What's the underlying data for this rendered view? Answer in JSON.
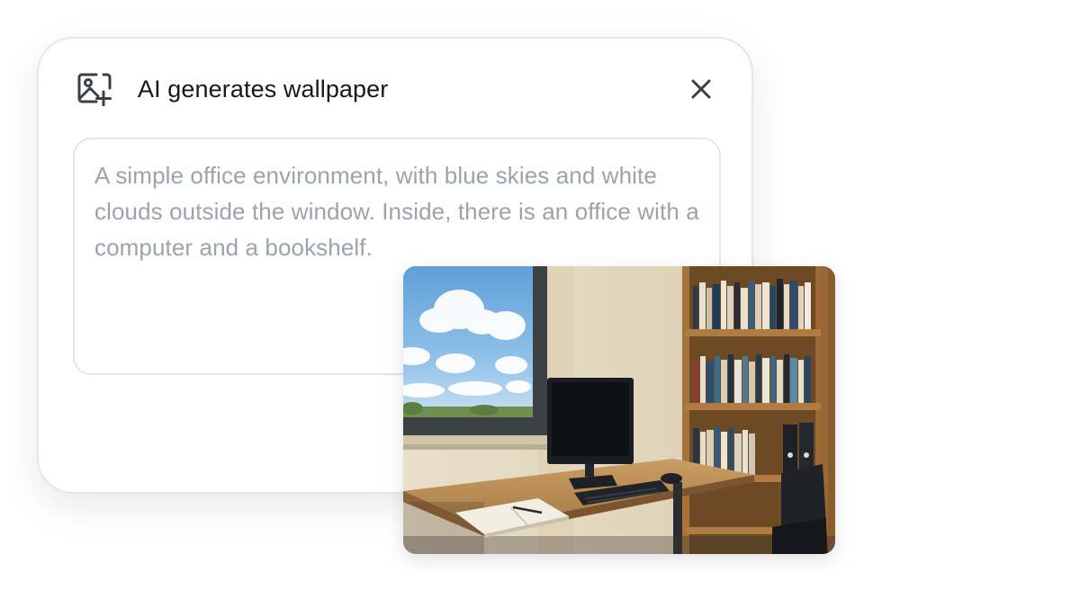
{
  "dialog": {
    "title": "AI generates wallpaper",
    "header_icon": "image-add-icon",
    "close_icon": "close-icon"
  },
  "prompt": {
    "text": "A simple office environment, with blue skies and white clouds outside the window. Inside, there is an office with a computer and a bookshelf."
  },
  "preview": {
    "description_icon": "generated-wallpaper-image"
  },
  "colors": {
    "title_text": "#16181d",
    "prompt_text": "#9ba3ae",
    "border": "#e4e6ea",
    "icon": "#3a3f47"
  }
}
